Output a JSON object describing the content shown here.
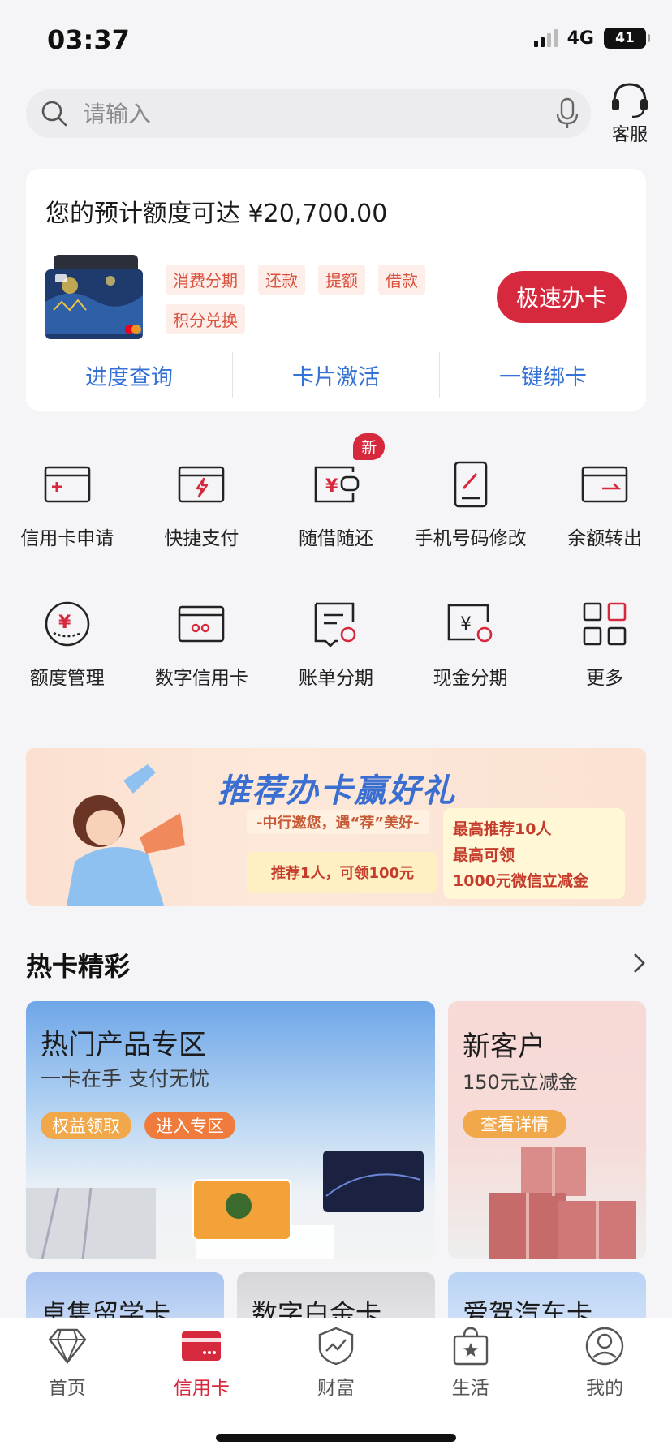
{
  "status_bar": {
    "time": "03:37",
    "network": "4G",
    "battery": "41"
  },
  "search": {
    "placeholder": "请输入"
  },
  "service": {
    "label": "客服"
  },
  "limit_card": {
    "title": "您的预计额度可达 ¥20,700.00",
    "tags": [
      "消费分期",
      "还款",
      "提额",
      "借款",
      "积分兑换"
    ],
    "apply_button": "极速办卡",
    "quick_links": [
      "进度查询",
      "卡片激活",
      "一键绑卡"
    ]
  },
  "grid": {
    "row1": [
      "信用卡申请",
      "快捷支付",
      "随借随还",
      "手机号码修改",
      "余额转出"
    ],
    "row2": [
      "额度管理",
      "数字信用卡",
      "账单分期",
      "现金分期",
      "更多"
    ],
    "new_badge": "新"
  },
  "banner": {
    "title": "推荐办卡赢好礼",
    "subtitle": "-中行邀您，遇“荐”美好-",
    "left_box": "推荐1人，可领100元",
    "right_line1": "最高推荐10人",
    "right_line2": "最高可领",
    "right_line3": "1000元微信立减金"
  },
  "hot_cards": {
    "section_title": "热卡精彩",
    "main": {
      "title": "热门产品专区",
      "subtitle": "一卡在手 支付无忧",
      "btn_benefit": "权益领取",
      "btn_enter": "进入专区"
    },
    "new_customer": {
      "title": "新客户",
      "subtitle": "150元立减金",
      "btn": "查看详情"
    },
    "strips": [
      "卓隽留学卡",
      "数字白金卡",
      "爱驾汽车卡"
    ]
  },
  "bottom_nav": {
    "items": [
      "首页",
      "信用卡",
      "财富",
      "生活",
      "我的"
    ],
    "active": "信用卡"
  },
  "colors": {
    "brand_red": "#d6293d",
    "link_blue": "#3572d6",
    "tag_orange": "#d9533f"
  }
}
